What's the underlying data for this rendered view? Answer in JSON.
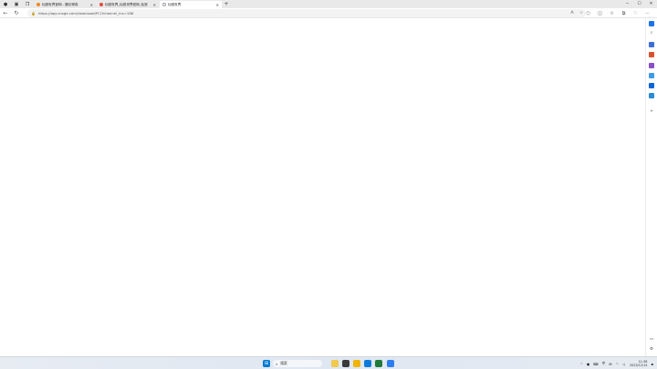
{
  "tabs": [
    {
      "title": "仙宫世界官网 - 魔幻修真",
      "favicon_color": "#f08a24",
      "active": false
    },
    {
      "title": "仙宫世界_仙宫世界官网_仙宫",
      "favicon_color": "#e24b3b",
      "active": false
    },
    {
      "title": "仙宫世界",
      "favicon_color": "#9aa0a6",
      "active": true
    }
  ],
  "address": {
    "url": "https://app.mxge.com/download/PC/?channel_inx=188"
  },
  "taskbar": {
    "search_placeholder": "搜索"
  },
  "tray": {
    "lang": "中",
    "time": "11:38",
    "date": "2023/12/14"
  },
  "colors": {
    "tabstrip_bg": "#e9e9ea",
    "accent_blue": "#0a64d8",
    "windows_logo": "#0078d4"
  }
}
